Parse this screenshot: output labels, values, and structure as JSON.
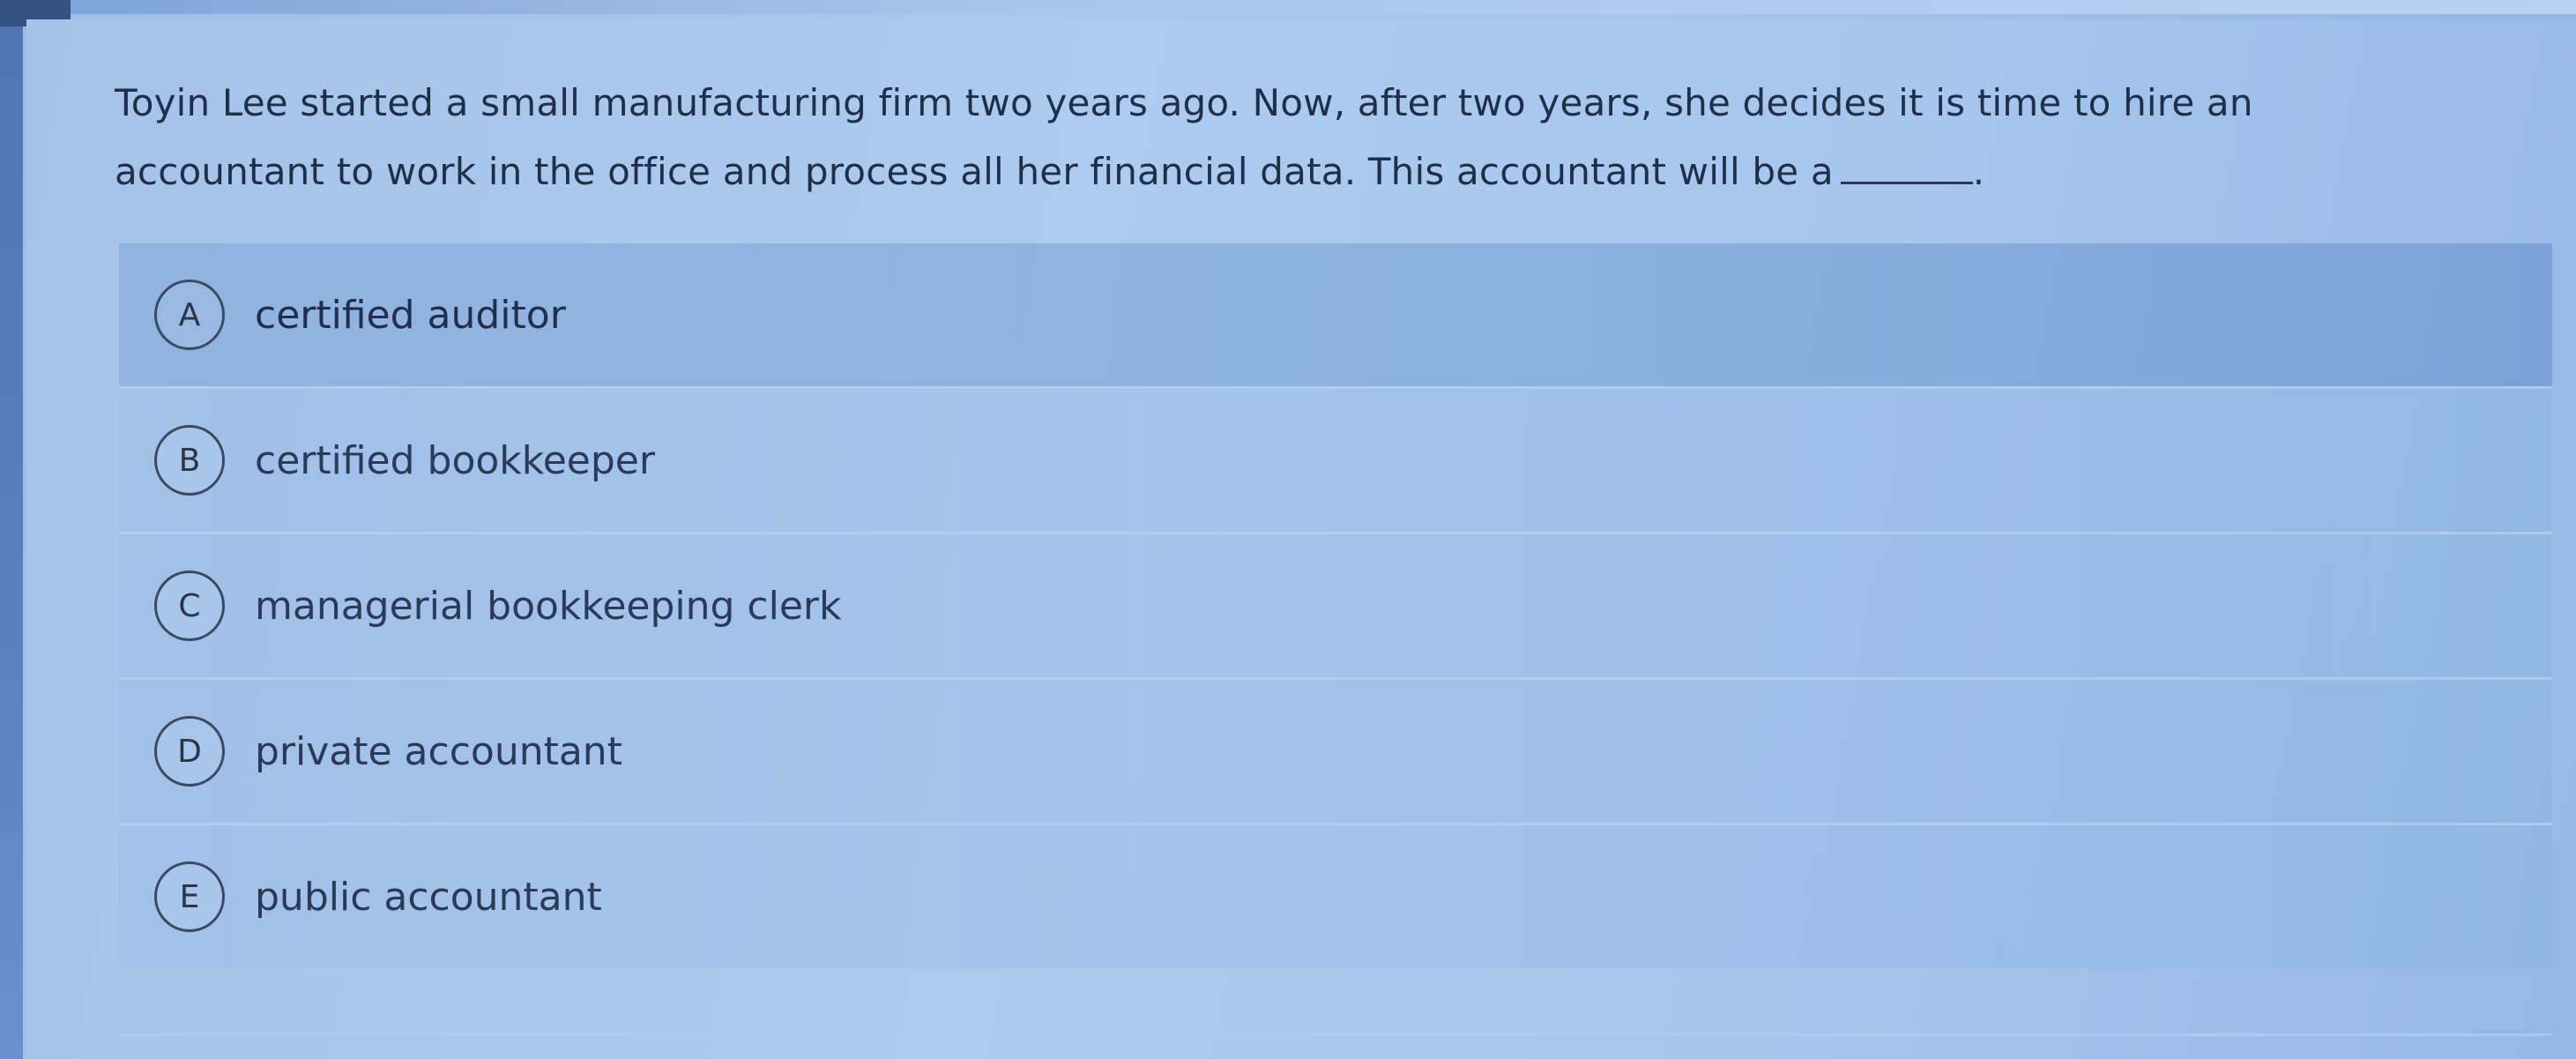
{
  "question": {
    "text": "Toyin Lee started a small manufacturing firm two years ago. Now, after two years, she decides it is time to hire an accountant to work in the office and process all her financial data. This accountant will be a",
    "end_punct": "."
  },
  "choices": [
    {
      "letter": "A",
      "label": "certified auditor"
    },
    {
      "letter": "B",
      "label": "certified bookkeeper"
    },
    {
      "letter": "C",
      "label": "managerial bookkeeping clerk"
    },
    {
      "letter": "D",
      "label": "private accountant"
    },
    {
      "letter": "E",
      "label": "public accountant"
    }
  ]
}
